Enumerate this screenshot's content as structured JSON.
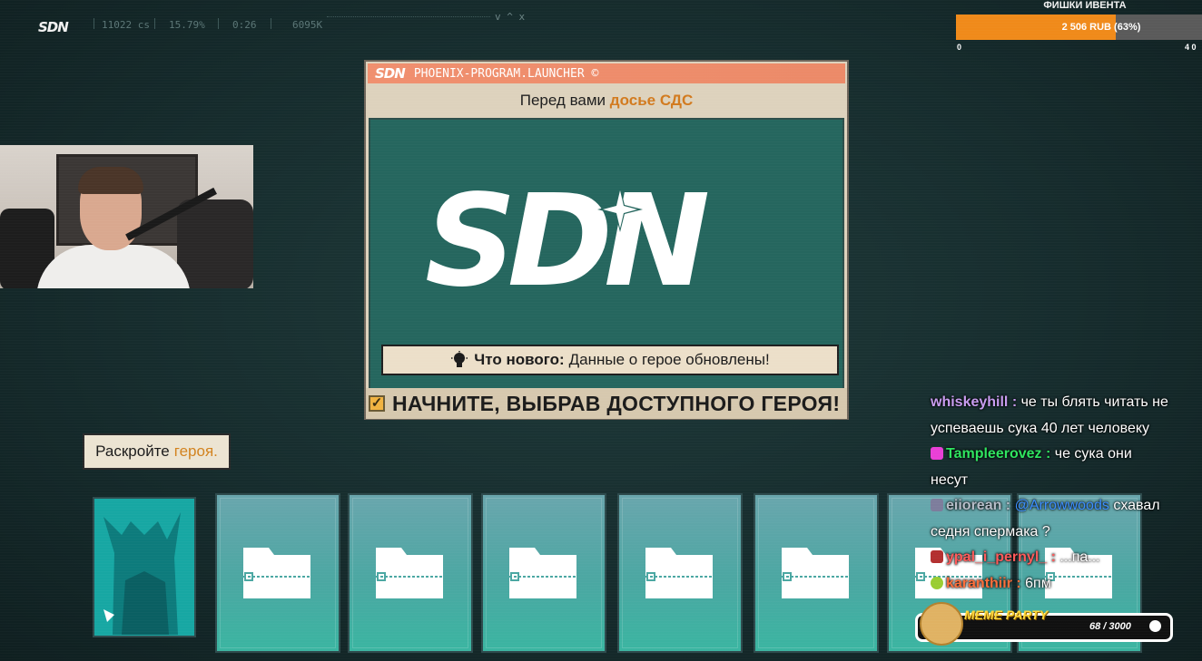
{
  "topbar": {
    "brand": "SDN",
    "stats": [
      "11022 cs",
      "15.79%",
      "0:26",
      "6095K"
    ],
    "window_controls": "v ^ x"
  },
  "event": {
    "title": "ФИШКИ ИВЕНТА",
    "progress_label": "2 506 RUB (63%)",
    "progress_fraction": 0.63,
    "min": "0",
    "max": "4 0",
    "bar_color": "#f08a1a"
  },
  "launcher": {
    "brand": "SDN",
    "title": "PHOENIX-PROGRAM.LAUNCHER ©",
    "subtitle_prefix": "Перед вами",
    "subtitle_highlight": "досье СДС",
    "logo_text": "SDN",
    "news_label": "Что нового:",
    "news_text": "Данные о герое обновлены!",
    "start_text": "НАЧНИТЕ, ВЫБРАВ ДОСТУПНОГО ГЕРОЯ!",
    "start_checked": true
  },
  "reveal": {
    "prefix": "Раскройте",
    "highlight": "героя."
  },
  "cards": {
    "count_folders": 7
  },
  "chat": [
    {
      "user": "whiskeyhill",
      "badge": "",
      "text": "че ты блять читать не"
    },
    {
      "user": "",
      "badge": "",
      "text": "успеваешь сука 40 лет человеку"
    },
    {
      "user": "Tampleerovez",
      "badge": "heart",
      "text": "че сука они"
    },
    {
      "user": "",
      "badge": "",
      "text": "несут"
    },
    {
      "user": "eiiorean",
      "badge": "cat",
      "mention": "@Arrowwoods",
      "text": "схавал"
    },
    {
      "user": "",
      "badge": "",
      "text": "седня спермака ?"
    },
    {
      "user": "ypal_i_pernyl_",
      "badge": "stamp",
      "text": "...па..."
    },
    {
      "user": "karanthiir",
      "badge": "frog",
      "text": "6пм"
    }
  ],
  "meme_party": {
    "title": "MEME PARTY",
    "count": "68 / 3000"
  }
}
